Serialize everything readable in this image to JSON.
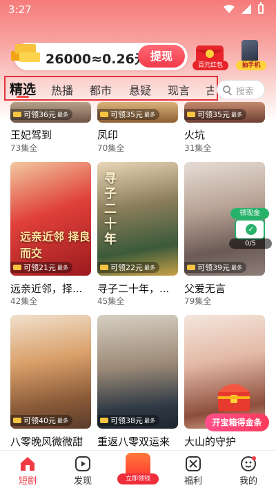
{
  "status": {
    "time": "3:27"
  },
  "header": {
    "coin_text": "26000≈0.26元",
    "withdraw_label": "提现",
    "redbag_label": "百元红包",
    "phone_label": "抽手机"
  },
  "tabs": [
    {
      "label": "精选",
      "active": true
    },
    {
      "label": "热播"
    },
    {
      "label": "都市"
    },
    {
      "label": "悬疑"
    },
    {
      "label": "现言"
    },
    {
      "label": "古"
    }
  ],
  "search": {
    "placeholder": "搜索"
  },
  "rows": [
    [
      {
        "badge": "可领36元",
        "title": "王妃驾到",
        "eps": "73集全"
      },
      {
        "badge": "可领35元",
        "title": "凤印",
        "eps": "70集全"
      },
      {
        "badge": "可领35元",
        "title": "火坑",
        "eps": "31集全"
      }
    ],
    [
      {
        "badge": "可领21元",
        "title": "远亲近邻，择...",
        "eps": "42集全",
        "poster_text": "远亲近邻 择良而交"
      },
      {
        "badge": "可领22元",
        "title": "寻子二十年，...",
        "eps": "45集全",
        "poster_text": "寻子二十年"
      },
      {
        "badge": "可领39元",
        "title": "父爱无言",
        "eps": "79集全"
      }
    ],
    [
      {
        "badge": "可领40元",
        "title": "八零晚风微微甜",
        "eps": ""
      },
      {
        "badge": "可领38元",
        "title": "重返八零双运来",
        "eps": ""
      },
      {
        "badge": "",
        "title": "大山的守护",
        "eps": ""
      }
    ]
  ],
  "badge_suffix": "最多",
  "widgets": {
    "cash_label": "领现金",
    "progress": "0/5",
    "chest_label": "开宝箱得金条"
  },
  "nav": [
    {
      "label": "短剧",
      "icon": "home-icon",
      "active": true
    },
    {
      "label": "发现",
      "icon": "play-icon"
    },
    {
      "label": "立即领钱",
      "icon": "coin-bag-icon"
    },
    {
      "label": "福利",
      "icon": "gift-icon"
    },
    {
      "label": "我的",
      "icon": "profile-icon"
    }
  ],
  "colors": {
    "accent": "#f03b45",
    "header": "#f67b7b"
  }
}
